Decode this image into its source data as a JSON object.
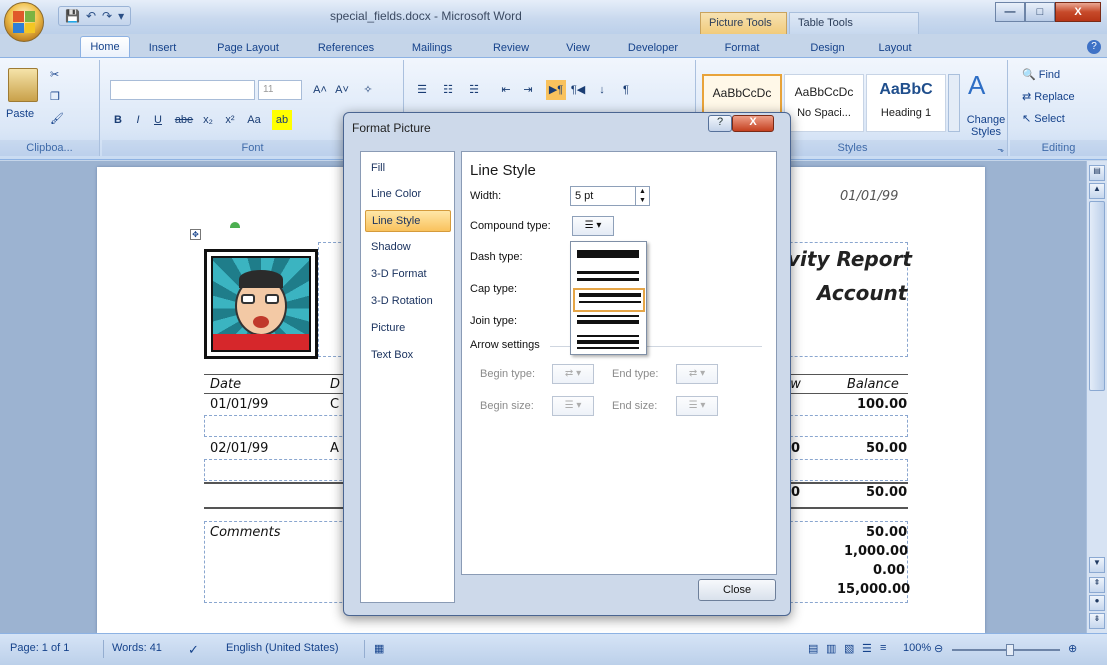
{
  "window": {
    "title": "special_fields.docx - Microsoft Word",
    "context_tabs": {
      "picture_tools": "Picture Tools",
      "table_tools": "Table Tools"
    },
    "controls": {
      "minimize": "—",
      "maximize": "□",
      "close": "X"
    }
  },
  "qat": {
    "save_icon": "💾",
    "undo_icon": "↶",
    "redo_icon": "↷",
    "more_icon": "▾"
  },
  "tabs": [
    "Home",
    "Insert",
    "Page Layout",
    "References",
    "Mailings",
    "Review",
    "View",
    "Developer",
    "Format",
    "Design",
    "Layout"
  ],
  "help_label": "?",
  "ribbon": {
    "clipboard": {
      "label": "Clipboa...",
      "paste_label": "Paste"
    },
    "font": {
      "label": "Font",
      "font_size": "11",
      "grow": "A˄",
      "shrink": "A˅",
      "bold": "B",
      "italic": "I",
      "underline": "U",
      "strike": "abe",
      "sub": "x₂",
      "sup": "x²",
      "case": "Aa"
    },
    "styles": {
      "label": "Styles",
      "items": [
        {
          "sample": "AaBbCcDc",
          "name": ""
        },
        {
          "sample": "AaBbCcDc",
          "name": "No Spaci..."
        },
        {
          "sample": "AaBbC",
          "name": "Heading 1"
        }
      ],
      "change_styles": "Change Styles"
    },
    "editing": {
      "label": "Editing",
      "find": "Find",
      "replace": "Replace",
      "select": "Select"
    }
  },
  "document": {
    "date_top": "01/01/99",
    "heading1": "vity Report",
    "heading2": "Account",
    "table": {
      "headers": {
        "date": "Date",
        "desc": "D",
        "withdraw": "raw",
        "balance": "Balance"
      },
      "rows": [
        {
          "date": "01/01/99",
          "desc": "C",
          "withdraw": "",
          "balance": "100.00"
        },
        {
          "date": "02/01/99",
          "desc": "A",
          "withdraw": ".00",
          "balance": "50.00"
        }
      ],
      "total_withdraw": ".00",
      "total_balance": "50.00",
      "comments_label": "Comments",
      "summary": [
        "50.00",
        "1,000.00",
        "0.00",
        "15,000.00"
      ]
    }
  },
  "dialog": {
    "title": "Format Picture",
    "help": "?",
    "close_x": "X",
    "nav": [
      "Fill",
      "Line Color",
      "Line Style",
      "Shadow",
      "3-D Format",
      "3-D Rotation",
      "Picture",
      "Text Box"
    ],
    "active_nav": "Line Style",
    "panel_title": "Line Style",
    "width_label": "Width:",
    "width_value": "5 pt",
    "compound_label": "Compound type:",
    "dash_label": "Dash type:",
    "cap_label": "Cap type:",
    "join_label": "Join type:",
    "arrow_settings": "Arrow settings",
    "begin_type": "Begin type:",
    "end_type": "End type:",
    "begin_size": "Begin size:",
    "end_size": "End size:",
    "close_button": "Close"
  },
  "status": {
    "page": "Page: 1 of 1",
    "words": "Words: 41",
    "language": "English (United States)",
    "zoom": "100%"
  }
}
